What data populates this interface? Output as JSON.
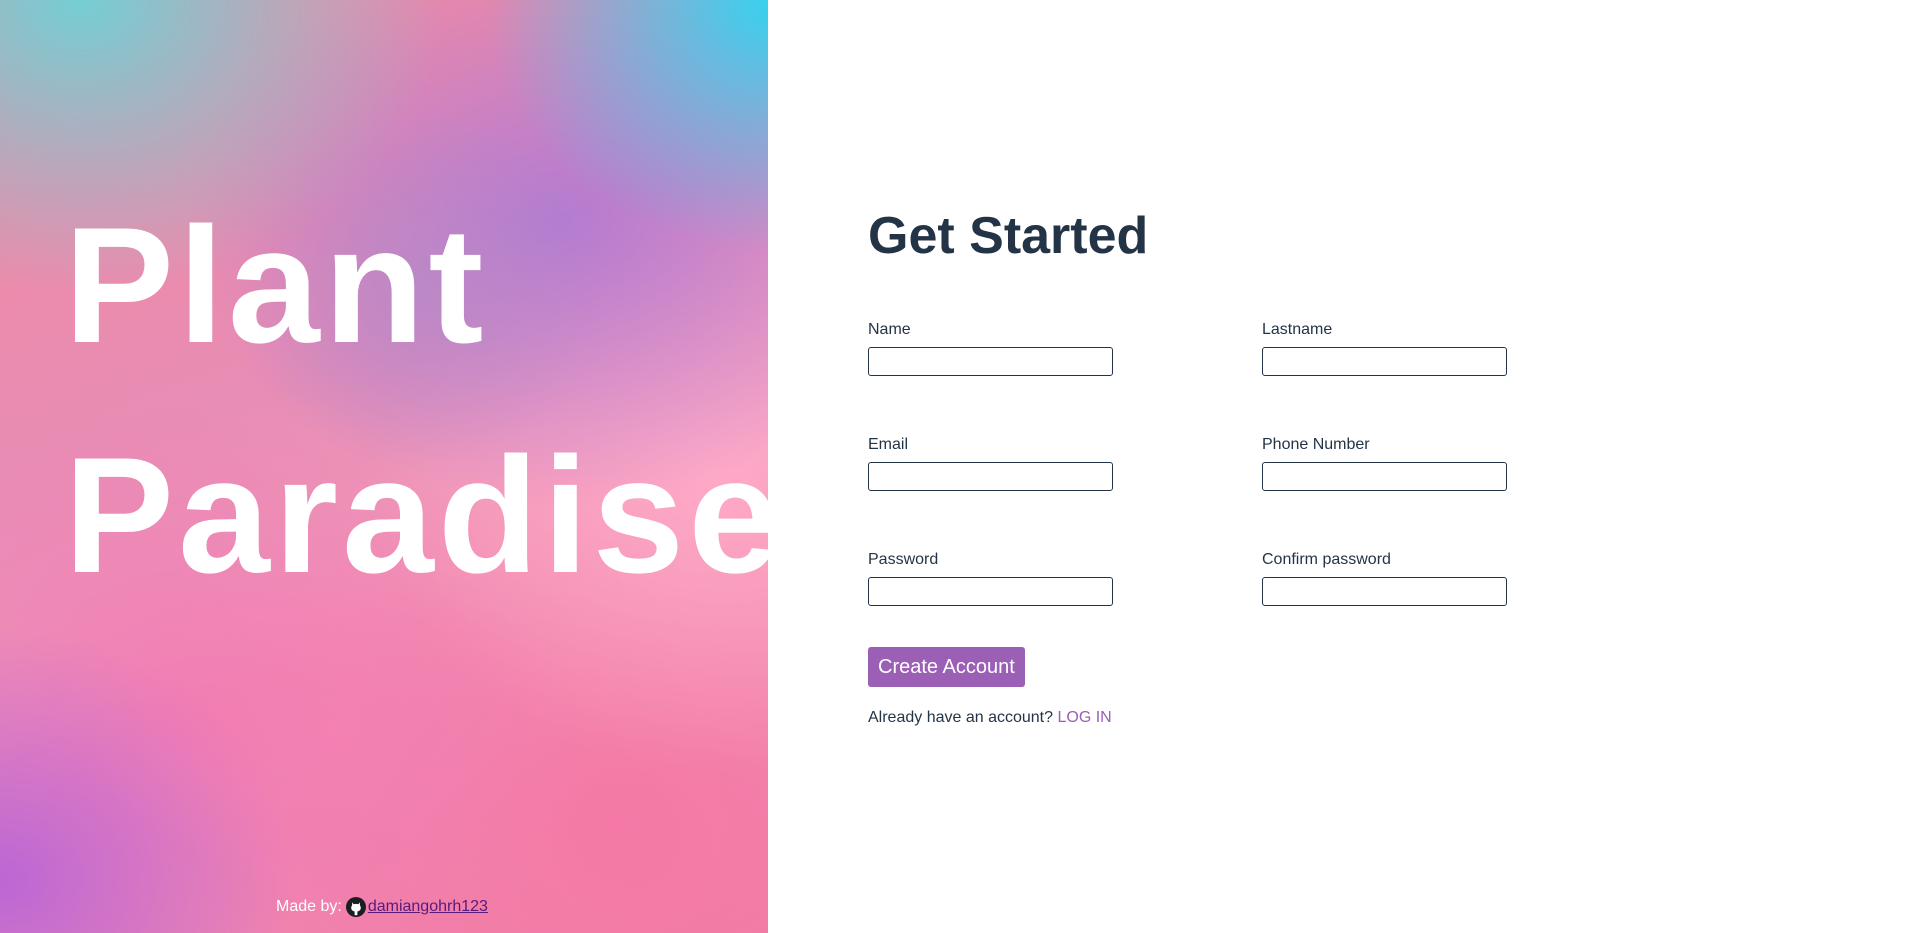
{
  "hero": {
    "title_line1": "Plant",
    "title_line2": "Paradise"
  },
  "credit": {
    "prefix": "Made by:",
    "icon": "github-icon",
    "link_text": " damiangohrh123"
  },
  "form": {
    "title": "Get Started",
    "fields": [
      {
        "label": "Name",
        "value": ""
      },
      {
        "label": "Lastname",
        "value": ""
      },
      {
        "label": "Email",
        "value": ""
      },
      {
        "label": "Phone Number",
        "value": ""
      },
      {
        "label": "Password",
        "value": ""
      },
      {
        "label": "Confirm password",
        "value": ""
      }
    ],
    "submit_label": "Create Account",
    "login_prompt": "Already have an account?",
    "login_link": "LOG IN"
  },
  "colors": {
    "accent": "#9b5fb5",
    "text": "#243447",
    "credit_link": "#5a1a7a"
  }
}
